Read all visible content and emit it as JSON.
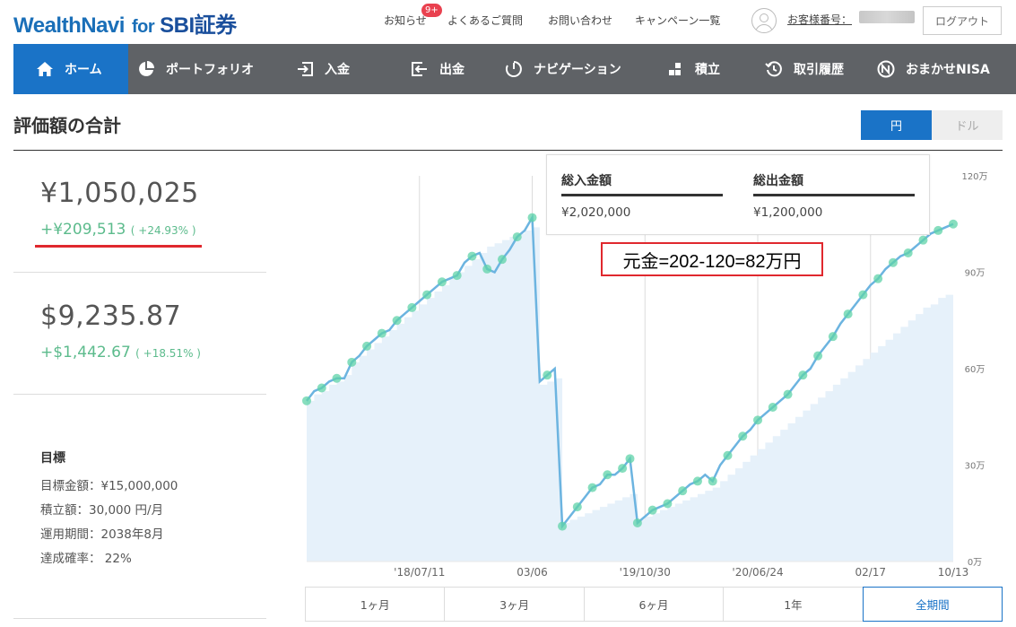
{
  "header": {
    "logo_main": "WealthNavi",
    "logo_for": "for",
    "logo_sbi": "SBI証券",
    "links": [
      "お知らせ",
      "よくあるご質問",
      "お問い合わせ",
      "キャンペーン一覧"
    ],
    "notice_badge": "9+",
    "customer_label": "お客様番号：",
    "logout_label": "ログアウト"
  },
  "nav": {
    "items": [
      {
        "label": "ホーム",
        "icon": "home-icon",
        "active": true
      },
      {
        "label": "ポートフォリオ",
        "icon": "pie-chart-icon",
        "active": false
      },
      {
        "label": "入金",
        "icon": "deposit-icon",
        "active": false
      },
      {
        "label": "出金",
        "icon": "withdraw-icon",
        "active": false
      },
      {
        "label": "ナビゲーション",
        "icon": "navigation-icon",
        "active": false
      },
      {
        "label": "積立",
        "icon": "blocks-icon",
        "active": false
      },
      {
        "label": "取引履歴",
        "icon": "history-icon",
        "active": false
      },
      {
        "label": "おまかせNISA",
        "icon": "nisa-icon",
        "active": false
      }
    ]
  },
  "page": {
    "title": "評価額の合計",
    "currency_yen": "円",
    "currency_usd": "ドル"
  },
  "summary": {
    "yen_total": "¥1,050,025",
    "yen_gain": "+¥209,513",
    "yen_gain_pct": "( +24.93% )",
    "usd_total": "$9,235.87",
    "usd_gain": "+$1,442.67",
    "usd_gain_pct": "( +18.51% )"
  },
  "goal": {
    "title": "目標",
    "rows": [
      "目標金額：¥15,000,000",
      "積立額：30,000 円/月",
      "運用期間：2038年8月",
      "達成確率： 22%"
    ]
  },
  "flow_box": {
    "deposit_label": "総入金額",
    "deposit_value": "¥2,020,000",
    "withdraw_label": "総出金額",
    "withdraw_value": "¥1,200,000"
  },
  "annotation": "元金=202-120=82万円",
  "period_tabs": [
    "1ヶ月",
    "3ヶ月",
    "6ヶ月",
    "1年",
    "全期間"
  ],
  "colors": {
    "accent": "#1a73c7",
    "line": "#6cb4e0",
    "area": "#e6f1fa",
    "gain": "#5cbb8c",
    "marker": "#5fd3a8",
    "highlight": "#e0282e"
  },
  "chart_data": {
    "type": "line",
    "x_ticks": [
      "'18/07/11",
      "03/06",
      "'19/10/30",
      "'20/06/24",
      "02/17",
      "10/13"
    ],
    "y_ticks": [
      "0万",
      "30万",
      "60万",
      "90万",
      "120万"
    ],
    "ylim": [
      0,
      120
    ],
    "y_unit": "万円",
    "series": [
      {
        "values": [
          50,
          53,
          54,
          56,
          57,
          57,
          62,
          64,
          67,
          69,
          71,
          72,
          75,
          77,
          79,
          81,
          83,
          85,
          87,
          88,
          89,
          93,
          95,
          96,
          91,
          90,
          94,
          97,
          101,
          103,
          107,
          56,
          58,
          60,
          11,
          14,
          17,
          20,
          23,
          24,
          27,
          27,
          29,
          32,
          12,
          14,
          16,
          17,
          18,
          20,
          22,
          24,
          25,
          27,
          25,
          30,
          33,
          36,
          39,
          41,
          44,
          46,
          48,
          50,
          52,
          55,
          58,
          60,
          64,
          67,
          70,
          74,
          77,
          80,
          83,
          86,
          88,
          91,
          93,
          95,
          96,
          98,
          100,
          102,
          103,
          104,
          105
        ]
      },
      {
        "values": [
          50,
          52,
          53,
          55,
          56,
          58,
          62,
          64,
          66,
          68,
          70,
          72,
          74,
          76,
          78,
          80,
          82,
          84,
          86,
          88,
          90,
          92,
          94,
          96,
          98,
          99,
          100,
          101,
          102,
          103,
          104,
          55,
          56,
          57,
          12,
          13,
          14,
          15,
          16,
          17,
          18,
          19,
          20,
          21,
          13,
          14,
          15,
          16,
          17,
          18,
          19,
          20,
          21,
          22,
          23,
          25,
          27,
          29,
          31,
          33,
          35,
          37,
          39,
          41,
          43,
          45,
          47,
          49,
          51,
          53,
          55,
          57,
          59,
          61,
          63,
          65,
          67,
          69,
          71,
          73,
          75,
          77,
          79,
          80,
          82,
          83,
          84
        ]
      }
    ]
  }
}
